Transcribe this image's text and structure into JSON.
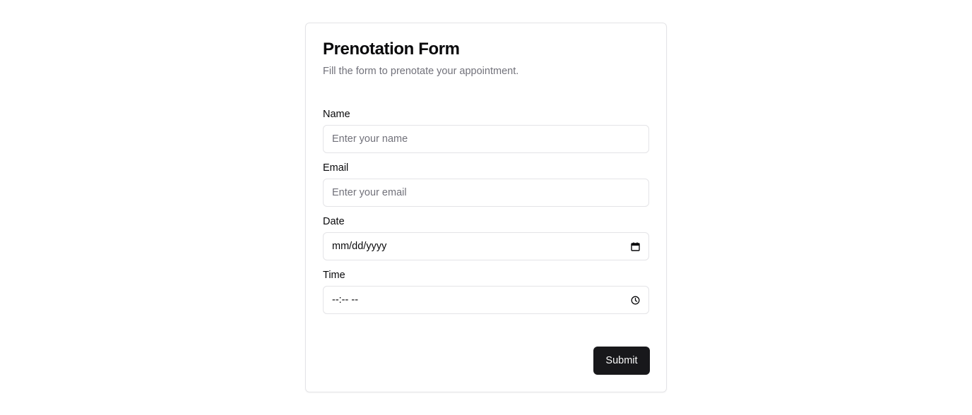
{
  "form": {
    "title": "Prenotation Form",
    "description": "Fill the form to prenotate your appointment.",
    "fields": {
      "name": {
        "label": "Name",
        "placeholder": "Enter your name",
        "value": ""
      },
      "email": {
        "label": "Email",
        "placeholder": "Enter your email",
        "value": ""
      },
      "date": {
        "label": "Date",
        "display": "mm/dd/yyyy",
        "icon": "calendar-icon"
      },
      "time": {
        "label": "Time",
        "display": "--:-- --",
        "icon": "clock-icon"
      }
    },
    "submit_label": "Submit"
  },
  "colors": {
    "primary": "#18181b",
    "muted_text": "#71717a",
    "border": "#e4e4e7"
  }
}
